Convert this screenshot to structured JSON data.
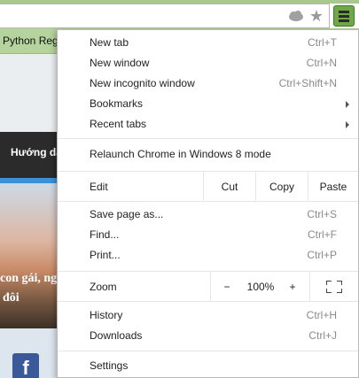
{
  "bookmarks_bar": {
    "item": "Python Regu"
  },
  "page": {
    "nav_text": "Hướng dẫ",
    "caption_line1": "con gái, ngư",
    "caption_line2": "đôi",
    "facebook_glyph": "f"
  },
  "menu": {
    "group1": [
      {
        "label": "New tab",
        "shortcut": "Ctrl+T"
      },
      {
        "label": "New window",
        "shortcut": "Ctrl+N"
      },
      {
        "label": "New incognito window",
        "shortcut": "Ctrl+Shift+N"
      },
      {
        "label": "Bookmarks",
        "submenu": true
      },
      {
        "label": "Recent tabs",
        "submenu": true
      }
    ],
    "relaunch": {
      "label": "Relaunch Chrome in Windows 8 mode"
    },
    "edit": {
      "label": "Edit",
      "cut": "Cut",
      "copy": "Copy",
      "paste": "Paste"
    },
    "group3": [
      {
        "label": "Save page as...",
        "shortcut": "Ctrl+S"
      },
      {
        "label": "Find...",
        "shortcut": "Ctrl+F"
      },
      {
        "label": "Print...",
        "shortcut": "Ctrl+P"
      }
    ],
    "zoom": {
      "label": "Zoom",
      "minus": "−",
      "level": "100%",
      "plus": "+"
    },
    "group5": [
      {
        "label": "History",
        "shortcut": "Ctrl+H"
      },
      {
        "label": "Downloads",
        "shortcut": "Ctrl+J"
      }
    ],
    "settings": {
      "label": "Settings"
    }
  },
  "colors": {
    "toolbar_green": "#b5d39c",
    "menu_button_green": "#6fa84a"
  },
  "icons": {
    "omnibox_cloud": "cloud-icon",
    "bookmark_star": "star-icon",
    "menu": "hamburger-menu-icon",
    "fullscreen": "fullscreen-icon",
    "submenu": "chevron-right-icon"
  }
}
